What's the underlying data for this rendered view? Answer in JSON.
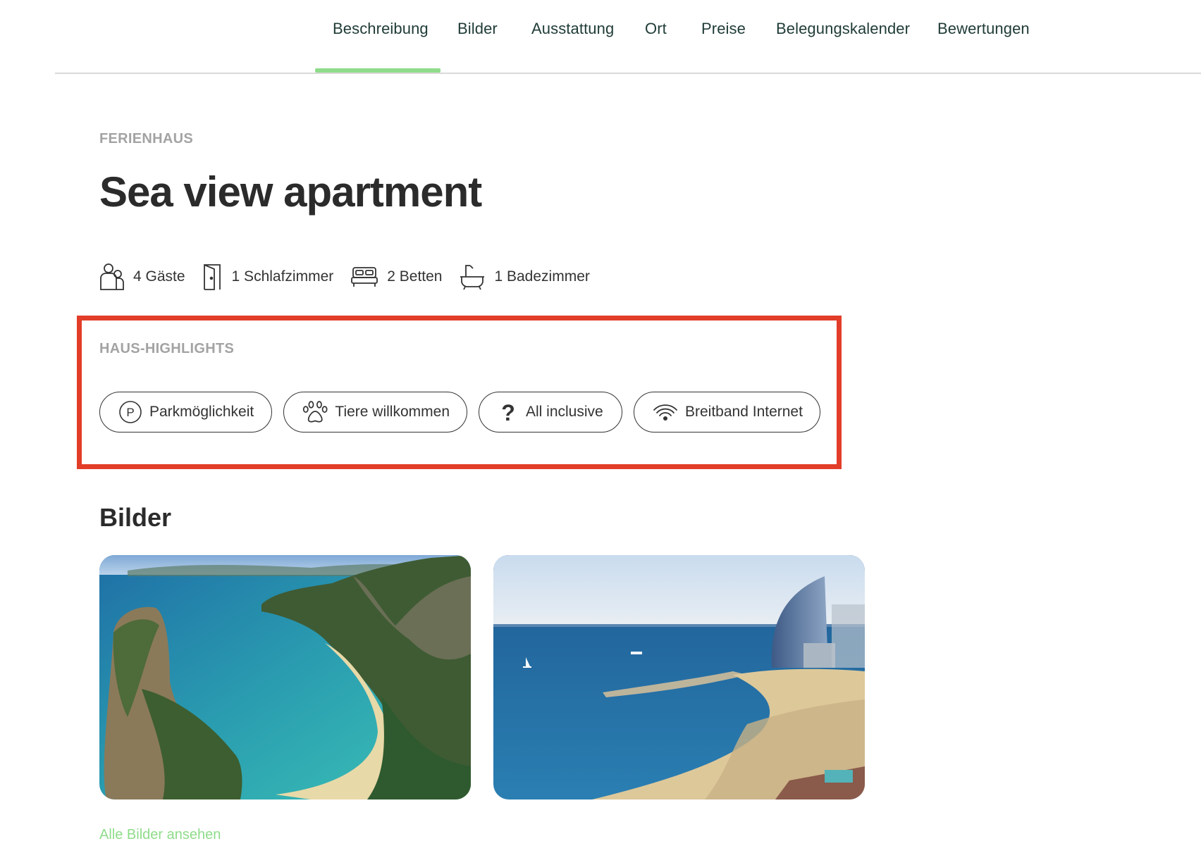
{
  "nav": {
    "items": [
      "Beschreibung",
      "Bilder",
      "Ausstattung",
      "Ort",
      "Preise",
      "Belegungskalender",
      "Bewertungen"
    ],
    "active": "Beschreibung"
  },
  "property": {
    "type": "FERIENHAUS",
    "title": "Sea view apartment"
  },
  "facts": {
    "guests": "4 Gäste",
    "bedrooms": "1 Schlafzimmer",
    "beds": "2 Betten",
    "bathrooms": "1 Badezimmer"
  },
  "highlights": {
    "heading": "HAUS-HIGHLIGHTS",
    "chips": [
      {
        "label": "Parkmöglichkeit",
        "icon": "parking-icon"
      },
      {
        "label": "Tiere willkommen",
        "icon": "paw-icon"
      },
      {
        "label": "All inclusive",
        "icon": "question-icon"
      },
      {
        "label": "Breitband Internet",
        "icon": "wifi-icon"
      }
    ]
  },
  "gallery": {
    "heading": "Bilder",
    "photos": [
      "tropical-bay-photo",
      "beach-hotel-photo"
    ],
    "all_link": "Alle Bilder ansehen"
  },
  "colors": {
    "accent_green": "#8fdc8a",
    "highlight_red": "#e23d28",
    "nav_text": "#1f3b36"
  }
}
